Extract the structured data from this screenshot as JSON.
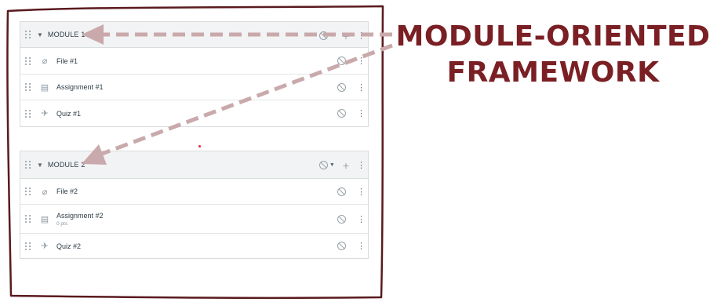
{
  "modules": [
    {
      "title": "MODULE 1",
      "items": [
        {
          "title": "File #1",
          "subtitle": "",
          "icon": "paperclip-icon"
        },
        {
          "title": "Assignment #1",
          "subtitle": "",
          "icon": "assignment-icon"
        },
        {
          "title": "Quiz #1",
          "subtitle": "",
          "icon": "quiz-rocket-icon"
        }
      ]
    },
    {
      "title": "MODULE 2",
      "items": [
        {
          "title": "File #2",
          "subtitle": "",
          "icon": "paperclip-icon"
        },
        {
          "title": "Assignment #2",
          "subtitle": "0 pts",
          "icon": "assignment-icon"
        },
        {
          "title": "Quiz #2",
          "subtitle": "",
          "icon": "quiz-rocket-icon"
        }
      ]
    }
  ],
  "callout": {
    "line1": "MODULE-ORIENTED",
    "line2": "FRAMEWORK"
  },
  "colors": {
    "accent": "#7a1f24",
    "arrow": "#c9a9ab",
    "frame": "#5a1a1e"
  }
}
